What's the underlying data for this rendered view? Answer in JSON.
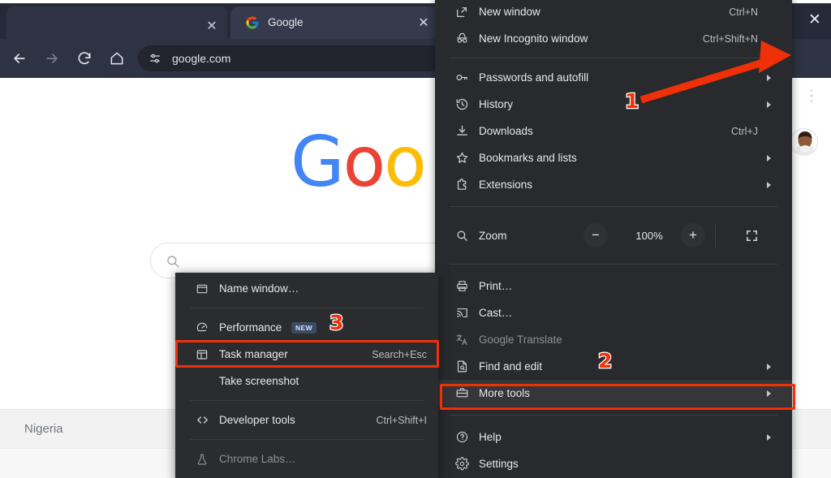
{
  "window": {
    "close_label": "✕"
  },
  "tabs": {
    "previous_tab_close": "✕",
    "active": {
      "title": "Google",
      "favicon": "google-favicon",
      "close_label": "✕"
    }
  },
  "toolbar": {
    "back": "back-arrow",
    "forward": "forward-arrow",
    "reload": "reload",
    "home": "home",
    "site_info_icon": "tune-icon",
    "address": "google.com",
    "menu_button": "three-dot-menu",
    "avatar": "profile-avatar"
  },
  "page": {
    "logo_letters": [
      {
        "char": "G",
        "color": "#4285F4"
      },
      {
        "char": "o",
        "color": "#EA4335"
      },
      {
        "char": "o",
        "color": "#FBBC05"
      }
    ],
    "search_placeholder": "",
    "footer_region": "Nigeria"
  },
  "main_menu": {
    "items": [
      {
        "id": "new-window",
        "label": "New window",
        "accel": "Ctrl+N",
        "icon": "new-window-icon",
        "arrow": false,
        "dim": false
      },
      {
        "id": "new-incognito",
        "label": "New Incognito window",
        "accel": "Ctrl+Shift+N",
        "icon": "incognito-icon",
        "arrow": false,
        "dim": false
      },
      {
        "id": "passwords",
        "label": "Passwords and autofill",
        "accel": "",
        "icon": "key-icon",
        "arrow": true,
        "dim": false
      },
      {
        "id": "history",
        "label": "History",
        "accel": "",
        "icon": "history-icon",
        "arrow": true,
        "dim": false
      },
      {
        "id": "downloads",
        "label": "Downloads",
        "accel": "Ctrl+J",
        "icon": "download-icon",
        "arrow": false,
        "dim": false
      },
      {
        "id": "bookmarks",
        "label": "Bookmarks and lists",
        "accel": "",
        "icon": "star-icon",
        "arrow": true,
        "dim": false
      },
      {
        "id": "extensions",
        "label": "Extensions",
        "accel": "",
        "icon": "extension-icon",
        "arrow": true,
        "dim": false
      },
      {
        "id": "print",
        "label": "Print…",
        "accel": "",
        "icon": "printer-icon",
        "arrow": false,
        "dim": false
      },
      {
        "id": "cast",
        "label": "Cast…",
        "accel": "",
        "icon": "cast-icon",
        "arrow": false,
        "dim": false
      },
      {
        "id": "translate",
        "label": "Google Translate",
        "accel": "",
        "icon": "translate-icon",
        "arrow": false,
        "dim": true
      },
      {
        "id": "find-and-edit",
        "label": "Find and edit",
        "accel": "",
        "icon": "find-icon",
        "arrow": true,
        "dim": false
      },
      {
        "id": "more-tools",
        "label": "More tools",
        "accel": "",
        "icon": "toolbox-icon",
        "arrow": true,
        "dim": false
      },
      {
        "id": "help",
        "label": "Help",
        "accel": "",
        "icon": "help-icon",
        "arrow": true,
        "dim": false
      },
      {
        "id": "settings",
        "label": "Settings",
        "accel": "",
        "icon": "gear-icon",
        "arrow": false,
        "dim": false
      }
    ],
    "zoom": {
      "label": "Zoom",
      "icon": "magnifier-icon",
      "minus": "−",
      "level": "100%",
      "plus": "+",
      "fullscreen_icon": "fullscreen-icon"
    }
  },
  "more_tools_submenu": {
    "items": [
      {
        "id": "name-window",
        "label": "Name window…",
        "accel": "",
        "icon": "window-icon",
        "badge": ""
      },
      {
        "id": "performance",
        "label": "Performance",
        "accel": "",
        "icon": "speed-icon",
        "badge": "NEW"
      },
      {
        "id": "task-manager",
        "label": "Task manager",
        "accel": "Search+Esc",
        "icon": "task-grid-icon",
        "badge": ""
      },
      {
        "id": "take-screenshot",
        "label": "Take screenshot",
        "accel": "",
        "icon": "",
        "badge": ""
      },
      {
        "id": "developer-tools",
        "label": "Developer tools",
        "accel": "Ctrl+Shift+I",
        "icon": "code-icon",
        "badge": ""
      },
      {
        "id": "chrome-labs",
        "label": "Chrome Labs…",
        "accel": "",
        "icon": "flask-icon",
        "badge": ""
      }
    ]
  },
  "annotations": {
    "accent_color": "#f03008",
    "steps": [
      {
        "number": "1",
        "target": "three-dot-menu-button"
      },
      {
        "number": "2",
        "target": "more-tools-menu-item"
      },
      {
        "number": "3",
        "target": "task-manager-menu-item"
      }
    ]
  }
}
